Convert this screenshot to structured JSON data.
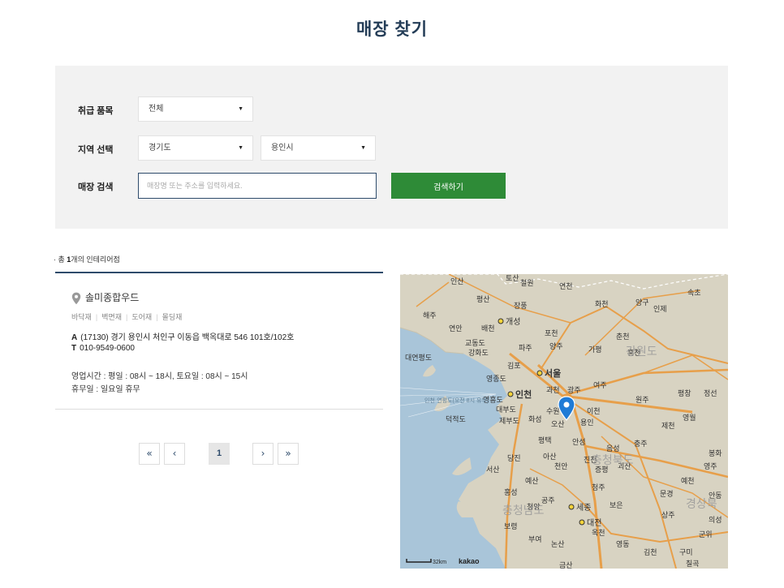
{
  "page": {
    "title": "매장 찾기"
  },
  "filters": {
    "category_label": "취급 품목",
    "category_value": "전체",
    "region_label": "지역 선택",
    "province_value": "경기도",
    "city_value": "용인시",
    "search_label": "매장 검색",
    "search_placeholder": "매장명 또는 주소를 입력하세요.",
    "search_button": "검색하기"
  },
  "results": {
    "prefix": "· 총 ",
    "count": "1",
    "suffix": "개의 인테리어점"
  },
  "store": {
    "name": "솔미종합우드",
    "tags": [
      "바닥재",
      "벽면재",
      "도어재",
      "몰딩재"
    ],
    "addr_prefix": "A",
    "address": "(17130) 경기 용인시 처인구 이동읍 백옥대로 546 101호/102호",
    "tel_prefix": "T",
    "phone": "010-9549-0600",
    "hours": "영업시간 : 평일 : 08시 ~ 18시, 토요일 : 08시 ~ 15시",
    "holiday": "휴무일 : 일요일 휴무"
  },
  "pagination": {
    "first": "«",
    "prev": "‹",
    "current": "1",
    "next": "›",
    "last": "»"
  },
  "map": {
    "scale": "32km",
    "brand": "kakao",
    "sea_label": "인천·연평도(오전 8시 유무)",
    "region_labels": [
      "강원도",
      "충청북도",
      "충청남도",
      "경상북"
    ],
    "cities": [
      {
        "name": "개성"
      },
      {
        "name": "서울"
      },
      {
        "name": "인천"
      },
      {
        "name": "수원"
      },
      {
        "name": "오산"
      },
      {
        "name": "화성"
      },
      {
        "name": "이천"
      },
      {
        "name": "안성"
      },
      {
        "name": "천안"
      },
      {
        "name": "원주"
      },
      {
        "name": "춘천"
      },
      {
        "name": "충주"
      },
      {
        "name": "제천"
      },
      {
        "name": "세종"
      },
      {
        "name": "대전"
      },
      {
        "name": "청주"
      },
      {
        "name": "당진"
      },
      {
        "name": "서산"
      },
      {
        "name": "보령"
      },
      {
        "name": "논산"
      },
      {
        "name": "공주"
      },
      {
        "name": "문경"
      },
      {
        "name": "상주"
      },
      {
        "name": "영주"
      },
      {
        "name": "구미"
      },
      {
        "name": "포천"
      },
      {
        "name": "양주"
      },
      {
        "name": "파주"
      },
      {
        "name": "김포"
      },
      {
        "name": "과천"
      },
      {
        "name": "광주"
      },
      {
        "name": "여주"
      },
      {
        "name": "홍천"
      },
      {
        "name": "평창"
      },
      {
        "name": "영월"
      },
      {
        "name": "진천"
      },
      {
        "name": "음성"
      },
      {
        "name": "괴산"
      },
      {
        "name": "보은"
      },
      {
        "name": "영동"
      },
      {
        "name": "철원"
      },
      {
        "name": "화천"
      },
      {
        "name": "양구"
      },
      {
        "name": "인제"
      },
      {
        "name": "속초"
      },
      {
        "name": "정선"
      },
      {
        "name": "봉화"
      },
      {
        "name": "예천"
      },
      {
        "name": "안동"
      },
      {
        "name": "의성"
      },
      {
        "name": "군위"
      },
      {
        "name": "칠곡"
      },
      {
        "name": "김천"
      },
      {
        "name": "옥천"
      },
      {
        "name": "증평"
      },
      {
        "name": "금산"
      },
      {
        "name": "부여"
      },
      {
        "name": "청양"
      },
      {
        "name": "예산"
      },
      {
        "name": "홍성"
      },
      {
        "name": "아산"
      },
      {
        "name": "평택"
      },
      {
        "name": "용인"
      },
      {
        "name": "가평"
      },
      {
        "name": "연천"
      },
      {
        "name": "장풍"
      },
      {
        "name": "해주"
      },
      {
        "name": "연안"
      },
      {
        "name": "평산"
      },
      {
        "name": "토산"
      },
      {
        "name": "인산"
      },
      {
        "name": "배천"
      },
      {
        "name": "교동도"
      },
      {
        "name": "강화도"
      },
      {
        "name": "대연평도"
      },
      {
        "name": "영종도"
      },
      {
        "name": "덕적도"
      },
      {
        "name": "대부도"
      },
      {
        "name": "영흥도"
      },
      {
        "name": "제부도"
      },
      {
        "name": "진천"
      },
      {
        "name": "단양"
      },
      {
        "name": "태백"
      },
      {
        "name": "증평"
      },
      {
        "name": "서천"
      }
    ]
  },
  "colors": {
    "title": "#243d57",
    "accent": "#2e4b6b",
    "button": "#2e8b37",
    "panel": "#f2f2f2",
    "marker": "#1f7bd6"
  }
}
